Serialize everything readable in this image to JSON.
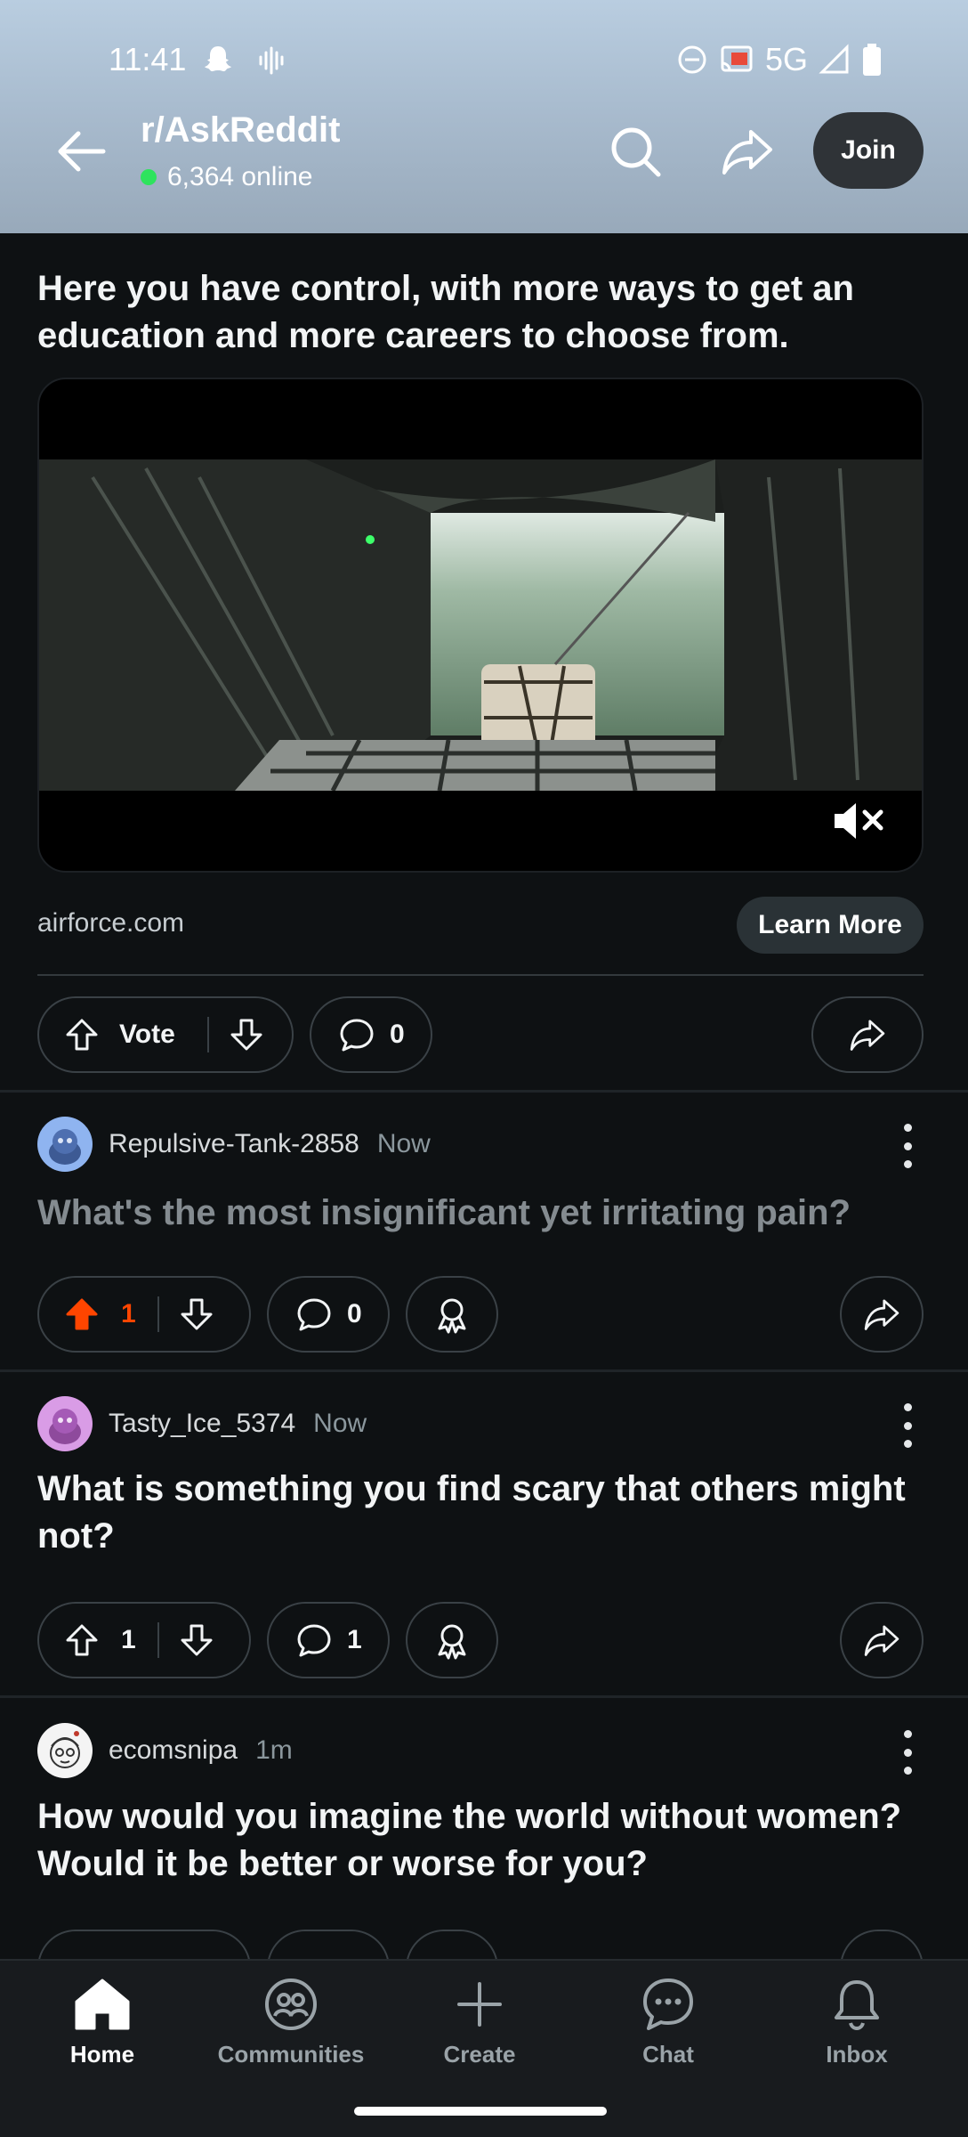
{
  "status_bar": {
    "time": "11:41",
    "network": "5G"
  },
  "header": {
    "subreddit": "r/AskReddit",
    "online_count": "6,364 online",
    "join_label": "Join"
  },
  "ad": {
    "title": "Here you have control, with more ways to get an education and more careers to choose from.",
    "domain": "airforce.com",
    "cta_label": "Learn More",
    "vote_label": "Vote",
    "comment_count": "0"
  },
  "posts": [
    {
      "username": "Repulsive-Tank-2858",
      "time": "Now",
      "title": "What's the most insignificant yet irritating pain?",
      "votes": "1",
      "comments": "0",
      "upvoted": true
    },
    {
      "username": "Tasty_Ice_5374",
      "time": "Now",
      "title": "What is something you find scary that others might not?",
      "votes": "1",
      "comments": "1",
      "upvoted": false
    },
    {
      "username": "ecomsnipa",
      "time": "1m",
      "title": "How would you imagine the world without women? Would it be better or worse for you?"
    }
  ],
  "bottom_nav": {
    "home": "Home",
    "communities": "Communities",
    "create": "Create",
    "chat": "Chat",
    "inbox": "Inbox"
  },
  "colors": {
    "background": "#0e1113",
    "upvote_active": "#ff4500",
    "online_dot": "#2ee35d",
    "join_button": "#2f3337"
  }
}
